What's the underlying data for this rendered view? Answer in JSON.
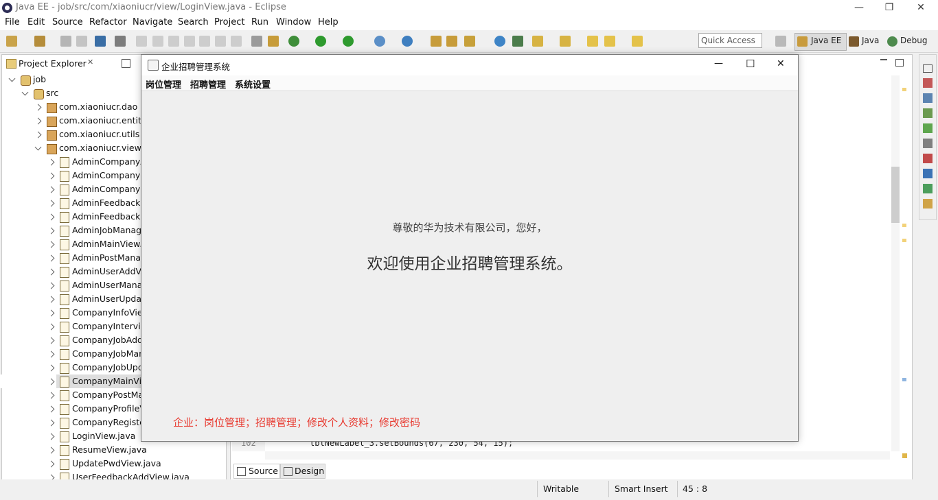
{
  "window": {
    "title": "Java EE - job/src/com/xiaoniucr/view/LoginView.java - Eclipse",
    "minimize": "—",
    "restore": "❐",
    "close": "✕"
  },
  "menubar": [
    "File",
    "Edit",
    "Source",
    "Refactor",
    "Navigate",
    "Search",
    "Project",
    "Run",
    "Window",
    "Help"
  ],
  "toolbar": {
    "quick_access_placeholder": "Quick Access",
    "perspectives": [
      "Java EE",
      "Java",
      "Debug"
    ]
  },
  "project_explorer": {
    "tab_label": "Project Explorer",
    "tab_close": "✕",
    "items": [
      {
        "label": "job",
        "level": 0,
        "expanded": true,
        "kind": "project"
      },
      {
        "label": "src",
        "level": 1,
        "expanded": true,
        "kind": "src"
      },
      {
        "label": "com.xiaoniucr.dao",
        "level": 2,
        "expanded": false,
        "kind": "package"
      },
      {
        "label": "com.xiaoniucr.entity",
        "level": 2,
        "expanded": false,
        "kind": "package"
      },
      {
        "label": "com.xiaoniucr.utils",
        "level": 2,
        "expanded": false,
        "kind": "package"
      },
      {
        "label": "com.xiaoniucr.view",
        "level": 2,
        "expanded": true,
        "kind": "package"
      },
      {
        "label": "AdminCompanyA",
        "level": 3,
        "kind": "file"
      },
      {
        "label": "AdminCompanyM",
        "level": 3,
        "kind": "file"
      },
      {
        "label": "AdminCompanyU",
        "level": 3,
        "kind": "file"
      },
      {
        "label": "AdminFeedbackM",
        "level": 3,
        "kind": "file"
      },
      {
        "label": "AdminFeedbackR",
        "level": 3,
        "kind": "file"
      },
      {
        "label": "AdminJobManag",
        "level": 3,
        "kind": "file"
      },
      {
        "label": "AdminMainView.j",
        "level": 3,
        "kind": "file"
      },
      {
        "label": "AdminPostManag",
        "level": 3,
        "kind": "file"
      },
      {
        "label": "AdminUserAddVi",
        "level": 3,
        "kind": "file"
      },
      {
        "label": "AdminUserManag",
        "level": 3,
        "kind": "file"
      },
      {
        "label": "AdminUserUpdat",
        "level": 3,
        "kind": "file"
      },
      {
        "label": "CompanyInfoView",
        "level": 3,
        "kind": "file"
      },
      {
        "label": "CompanyIntervie",
        "level": 3,
        "kind": "file"
      },
      {
        "label": "CompanyJobAdd",
        "level": 3,
        "kind": "file"
      },
      {
        "label": "CompanyJobMan",
        "level": 3,
        "kind": "file"
      },
      {
        "label": "CompanyJobUpd",
        "level": 3,
        "kind": "file"
      },
      {
        "label": "CompanyMainVie",
        "level": 3,
        "kind": "file",
        "selected": true
      },
      {
        "label": "CompanyPostMa",
        "level": 3,
        "kind": "file"
      },
      {
        "label": "CompanyProfileV",
        "level": 3,
        "kind": "file"
      },
      {
        "label": "CompanyRegiste",
        "level": 3,
        "kind": "file"
      },
      {
        "label": "LoginView.java",
        "level": 3,
        "kind": "file"
      },
      {
        "label": "ResumeView.java",
        "level": 3,
        "kind": "file"
      },
      {
        "label": "UpdatePwdView.java",
        "level": 3,
        "kind": "file"
      },
      {
        "label": "UserFeedbackAddView.java",
        "level": 3,
        "kind": "file"
      }
    ]
  },
  "editor": {
    "line_number": "102",
    "code_line": "lblNewLabel_3.setBounds(67, 230, 54, 15);",
    "bottom_tabs": [
      "Source",
      "Design"
    ]
  },
  "status_bar": {
    "mode": "Writable",
    "insert": "Smart Insert",
    "position": "45 : 8"
  },
  "dialog": {
    "title": "企业招聘管理系统",
    "menus": [
      "岗位管理",
      "招聘管理",
      "系统设置"
    ],
    "greeting": "尊敬的华为技术有限公司，您好，",
    "welcome": "欢迎使用企业招聘管理系统。",
    "footer_note": "企业：岗位管理；招聘管理；修改个人资料；修改密码",
    "footer_color": "#e8392f",
    "minimize": "—",
    "maximize": "☐",
    "close": "✕"
  }
}
